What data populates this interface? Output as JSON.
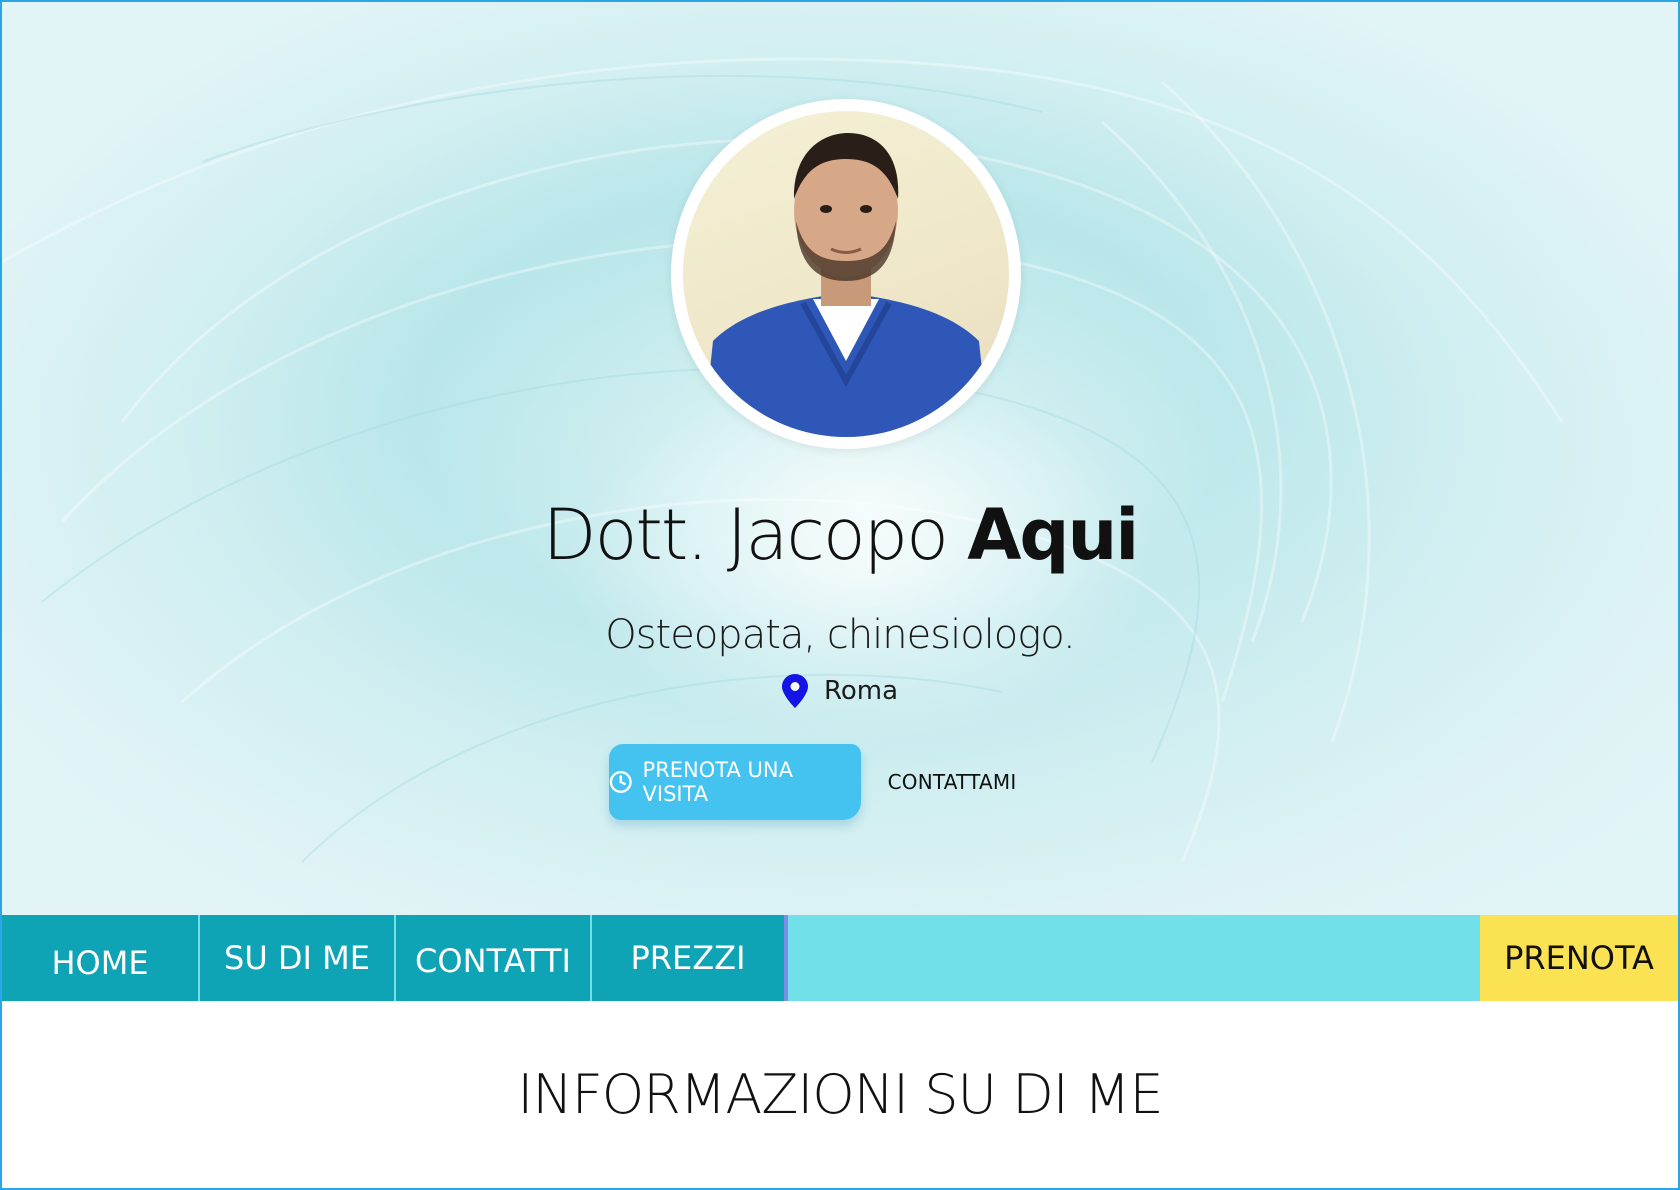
{
  "hero": {
    "name_first": "Dott. Jacopo",
    "name_last": "Aqui",
    "subtitle": "Osteopata, chinesiologo.",
    "location": "Roma",
    "book_button": "PRENOTA UNA VISITA",
    "contact_button": "CONTATTAMI",
    "colors": {
      "book_button_bg": "#45c3f0",
      "pin": "#1414e6"
    }
  },
  "nav": {
    "items": [
      {
        "label": "HOME"
      },
      {
        "label": "SU DI ME"
      },
      {
        "label": "CONTATTI"
      },
      {
        "label": "PREZZI"
      }
    ],
    "cta": "PRENOTA",
    "colors": {
      "item_bg": "#0fa3b6",
      "bar_bg": "#72e0e8",
      "cta_bg": "#fbe252"
    }
  },
  "section": {
    "title": "INFORMAZIONI SU DI ME"
  }
}
